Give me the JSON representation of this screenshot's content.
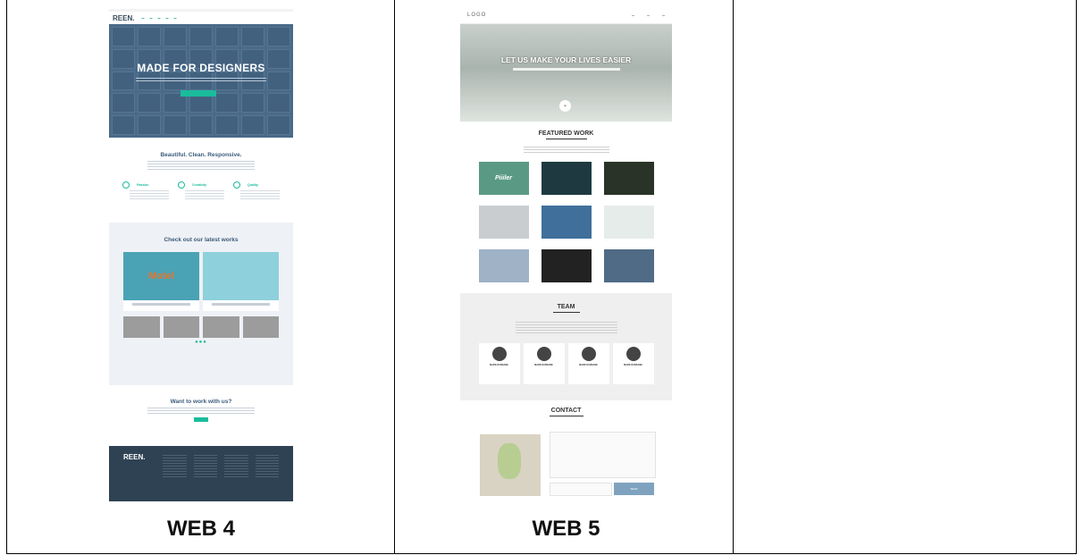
{
  "captions": {
    "web4": "WEB 4",
    "web5": "WEB 5"
  },
  "web4": {
    "logo": "REEN.",
    "hero_title": "MADE FOR DESIGNERS",
    "section_title": "Beautiful. Clean. Responsive.",
    "features": [
      "Passion",
      "Creativity",
      "Quality"
    ],
    "works_title": "Check out our latest works",
    "card_art": "Motel",
    "cta_title": "Want to work with us?",
    "footer_logo": "REEN.",
    "accent": "#1abc9c"
  },
  "web5": {
    "logo": "LOGO",
    "hero_title": "LET US MAKE YOUR LIVES EASIER",
    "featured_title": "FEATURED WORK",
    "portfolio_label": "Piiiler",
    "team_title": "TEAM",
    "member_name": "MARK DURKANE",
    "contact_title": "CONTACT",
    "send_label": "SEND"
  }
}
